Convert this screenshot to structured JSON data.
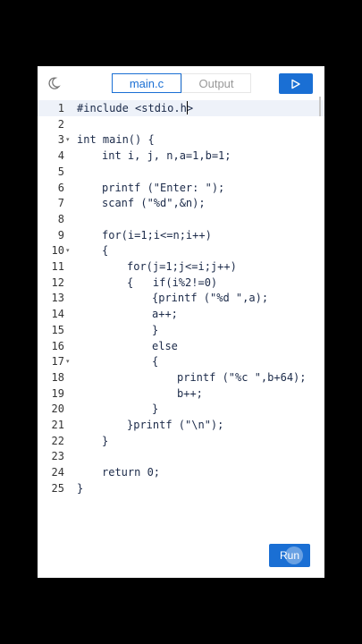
{
  "toolbar": {
    "theme_icon": "moon-icon",
    "tabs": [
      {
        "label": "main.c",
        "active": true
      },
      {
        "label": "Output",
        "active": false
      }
    ],
    "run_icon": "play-icon"
  },
  "editor": {
    "language": "C",
    "active_line": 1,
    "lines": [
      {
        "num": "1",
        "text": "#include <stdio.h>",
        "indent": 0
      },
      {
        "num": "2",
        "text": "",
        "indent": 0
      },
      {
        "num": "3",
        "text": "int main() {",
        "indent": 0,
        "fold": true
      },
      {
        "num": "4",
        "text": "int i, j, n,a=1,b=1;",
        "indent": 1
      },
      {
        "num": "5",
        "text": "",
        "indent": 0
      },
      {
        "num": "6",
        "text": "printf (\"Enter: \");",
        "indent": 1
      },
      {
        "num": "7",
        "text": "scanf (\"%d\",&n);",
        "indent": 1
      },
      {
        "num": "8",
        "text": "",
        "indent": 0
      },
      {
        "num": "9",
        "text": "for(i=1;i<=n;i++)",
        "indent": 1
      },
      {
        "num": "10",
        "text": "{",
        "indent": 1,
        "fold": true
      },
      {
        "num": "11",
        "text": "for(j=1;j<=i;j++)",
        "indent": 2
      },
      {
        "num": "12",
        "text": "{   if(i%2!=0)",
        "indent": 2
      },
      {
        "num": "13",
        "text": "{printf (\"%d \",a);",
        "indent": 3
      },
      {
        "num": "14",
        "text": "a++;",
        "indent": 3
      },
      {
        "num": "15",
        "text": "}",
        "indent": 3
      },
      {
        "num": "16",
        "text": "else",
        "indent": 3
      },
      {
        "num": "17",
        "text": "{",
        "indent": 3,
        "fold": true
      },
      {
        "num": "18",
        "text": "printf (\"%c \",b+64);",
        "indent": 4
      },
      {
        "num": "19",
        "text": "b++;",
        "indent": 4
      },
      {
        "num": "20",
        "text": "}",
        "indent": 3
      },
      {
        "num": "21",
        "text": "}printf (\"\\n\");",
        "indent": 2
      },
      {
        "num": "22",
        "text": "}",
        "indent": 1
      },
      {
        "num": "23",
        "text": "",
        "indent": 0
      },
      {
        "num": "24",
        "text": "return 0;",
        "indent": 1
      },
      {
        "num": "25",
        "text": "}",
        "indent": 0
      }
    ]
  },
  "run_button": {
    "label": "Run"
  },
  "colors": {
    "accent": "#1a6fd4",
    "active_line_bg": "#eef2f9",
    "code_text": "#1b2a49"
  }
}
